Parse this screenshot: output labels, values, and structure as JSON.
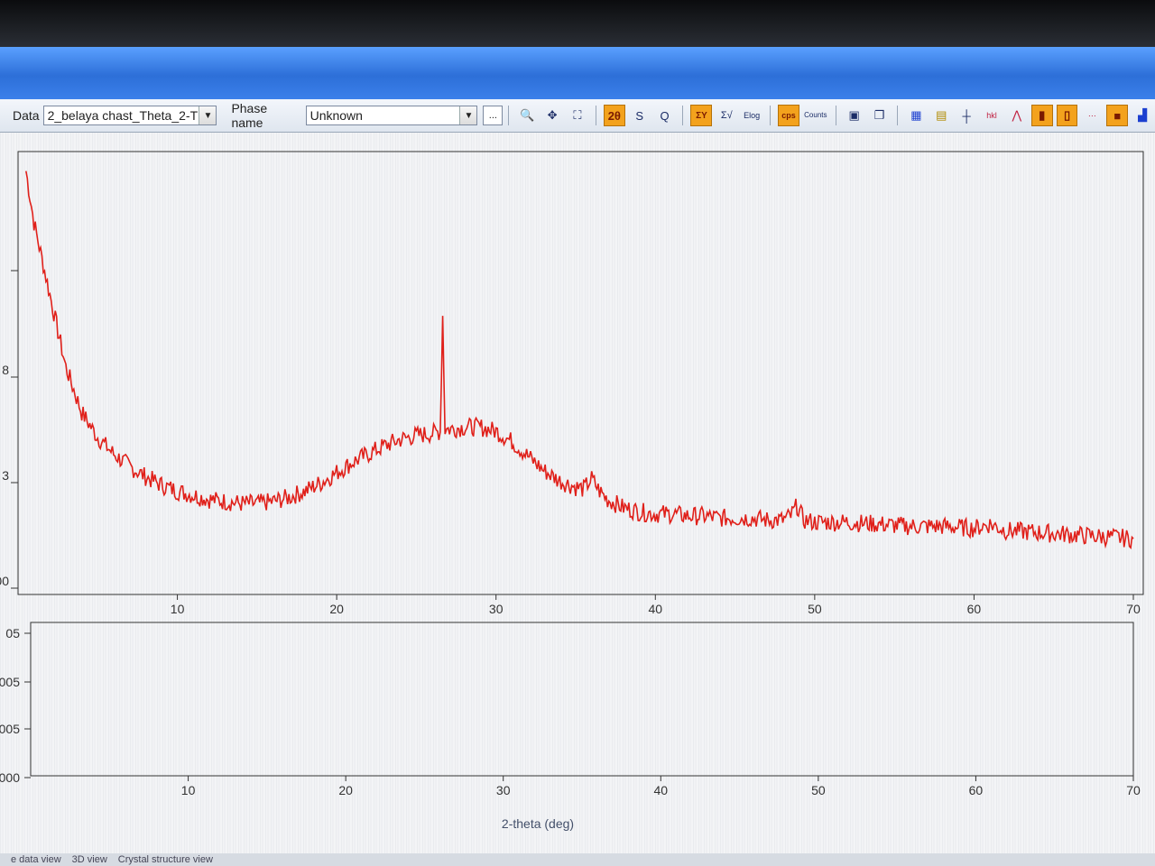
{
  "toolbar": {
    "data_label": "Data",
    "data_value": "2_belaya chast_Theta_2-T",
    "phase_label": "Phase name",
    "phase_value": "Unknown",
    "more_button": "...",
    "buttons": [
      "zoom-icon",
      "pan-icon",
      "fit-icon",
      "2θ",
      "S",
      "Q",
      "ΣY",
      "Σ√",
      "Elog",
      "cps",
      "Counts",
      "export-icon",
      "copy-icon",
      "grid-icon",
      "marker-icon",
      "tick-icon",
      "hkl-icon",
      "peak-icon",
      "bars-icon",
      "bars2-icon",
      "dots-icon",
      "box-icon",
      "chart-icon"
    ]
  },
  "chart_data": [
    {
      "type": "line",
      "name": "main-pattern",
      "xlabel": "",
      "ylabel": "",
      "xlim": [
        0,
        70
      ],
      "x_ticks": [
        10,
        20,
        30,
        40,
        50,
        60,
        70
      ],
      "y_tick_labels_partial": [
        "8",
        "3",
        "00"
      ],
      "series_color": "#e0201a",
      "series": [
        {
          "x": [
            0.5,
            1,
            2,
            3,
            4,
            5,
            6,
            7,
            8,
            9,
            10,
            11,
            12,
            13,
            14,
            15,
            16,
            17,
            18,
            19,
            20,
            21,
            22,
            23,
            24,
            25,
            26,
            26.5,
            26.65,
            26.8,
            27,
            28,
            29,
            30,
            31,
            32,
            33,
            34,
            35,
            35.5,
            36,
            36.5,
            37,
            38,
            39,
            40,
            41,
            42,
            43,
            44,
            45,
            46,
            47,
            48,
            48.5,
            48.9,
            49.3,
            50,
            52,
            54,
            56,
            58,
            60,
            61,
            62,
            64,
            66,
            68,
            70
          ],
          "y": [
            2.05,
            1.8,
            1.45,
            1.1,
            0.88,
            0.76,
            0.68,
            0.62,
            0.57,
            0.53,
            0.5,
            0.48,
            0.46,
            0.45,
            0.44,
            0.44,
            0.45,
            0.47,
            0.5,
            0.54,
            0.59,
            0.64,
            0.68,
            0.72,
            0.75,
            0.77,
            0.78,
            0.79,
            1.35,
            0.8,
            0.8,
            0.81,
            0.81,
            0.79,
            0.74,
            0.67,
            0.6,
            0.55,
            0.52,
            0.51,
            0.56,
            0.5,
            0.46,
            0.42,
            0.4,
            0.39,
            0.39,
            0.38,
            0.38,
            0.37,
            0.37,
            0.37,
            0.36,
            0.36,
            0.38,
            0.43,
            0.36,
            0.35,
            0.35,
            0.34,
            0.33,
            0.33,
            0.32,
            0.34,
            0.31,
            0.3,
            0.29,
            0.28,
            0.27
          ]
        }
      ],
      "ylim": [
        0,
        2.1
      ]
    },
    {
      "type": "line",
      "name": "difference-panel",
      "xlabel": "2-theta (deg)",
      "xlim": [
        0,
        70
      ],
      "x_ticks": [
        10,
        20,
        30,
        40,
        50,
        60,
        70
      ],
      "y_tick_labels_partial": [
        "05",
        "005",
        "005",
        "000"
      ],
      "series": []
    }
  ],
  "tabs": [
    "e data view",
    "3D view",
    "Crystal structure view"
  ]
}
